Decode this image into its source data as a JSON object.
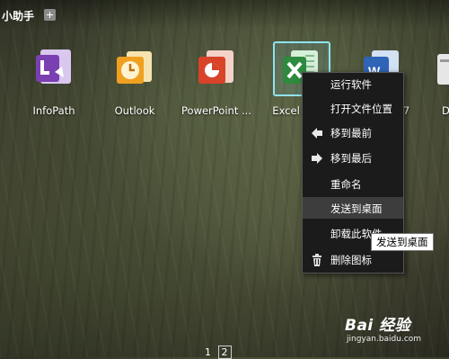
{
  "header": {
    "title": "小助手"
  },
  "apps": [
    {
      "label": "InfoPath"
    },
    {
      "label": "Outlook"
    },
    {
      "label": "PowerPoint ..."
    },
    {
      "label": "Excel 2007"
    },
    {
      "label": "Word 2007"
    },
    {
      "label": "D"
    }
  ],
  "context_menu": {
    "items": [
      {
        "label": "运行软件",
        "icon": ""
      },
      {
        "label": "打开文件位置",
        "icon": ""
      },
      {
        "label": "移到最前",
        "icon": "arrow-left-icon"
      },
      {
        "label": "移到最后",
        "icon": "arrow-right-icon"
      },
      {
        "label": "重命名",
        "icon": ""
      },
      {
        "label": "发送到桌面",
        "icon": ""
      },
      {
        "label": "卸载此软件",
        "icon": ""
      },
      {
        "label": "删除图标",
        "icon": "trash-icon"
      }
    ],
    "hovered_index": 5
  },
  "tooltip": {
    "text": "发送到桌面"
  },
  "pager": {
    "pages": [
      "1",
      "2"
    ],
    "active": "2"
  },
  "watermark": {
    "logo": "Bai 经验",
    "site": "jingyan.baidu.com"
  },
  "colors": {
    "infopath": "#7a3fb0",
    "outlook": "#f0a020",
    "powerpoint": "#d8432a",
    "excel": "#2e8a3e",
    "word": "#2f64b7",
    "selection": "#8fe3f2"
  }
}
